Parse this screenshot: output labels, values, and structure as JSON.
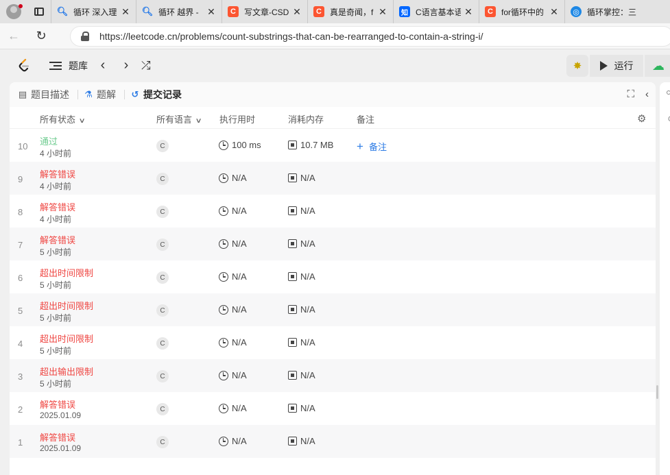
{
  "browser": {
    "tabs": [
      {
        "favicon": "search-icon",
        "title": "循环 深入理"
      },
      {
        "favicon": "search-icon",
        "title": "循环 越界 -"
      },
      {
        "favicon": "csdn-icon",
        "title": "写文章-CSD"
      },
      {
        "favicon": "csdn-icon",
        "title": "真是奇闻，f"
      },
      {
        "favicon": "zhihu-icon",
        "title": "C语言基本语"
      },
      {
        "favicon": "csdn-icon",
        "title": "for循环中的"
      },
      {
        "favicon": "edge-icon",
        "title": "循环掌控：三"
      }
    ],
    "url": "https://leetcode.cn/problems/count-substrings-that-can-be-rearranged-to-contain-a-string-i/"
  },
  "header": {
    "library_label": "题库",
    "run_label": "运行"
  },
  "panel": {
    "tabs": [
      {
        "label": "题目描述",
        "icon": "document-icon"
      },
      {
        "label": "题解",
        "icon": "flask-icon"
      },
      {
        "label": "提交记录",
        "icon": "history-icon"
      }
    ]
  },
  "table": {
    "columns": {
      "status": "所有状态",
      "language": "所有语言",
      "runtime": "执行用时",
      "memory": "消耗内存",
      "notes": "备注"
    },
    "rows": [
      {
        "index": "10",
        "status": "通过",
        "status_type": "accepted",
        "time": "4 小时前",
        "lang": "C",
        "runtime": "100 ms",
        "memory": "10.7 MB",
        "note": "备注"
      },
      {
        "index": "9",
        "status": "解答错误",
        "status_type": "error",
        "time": "4 小时前",
        "lang": "C",
        "runtime": "N/A",
        "memory": "N/A"
      },
      {
        "index": "8",
        "status": "解答错误",
        "status_type": "error",
        "time": "4 小时前",
        "lang": "C",
        "runtime": "N/A",
        "memory": "N/A"
      },
      {
        "index": "7",
        "status": "解答错误",
        "status_type": "error",
        "time": "5 小时前",
        "lang": "C",
        "runtime": "N/A",
        "memory": "N/A"
      },
      {
        "index": "6",
        "status": "超出时间限制",
        "status_type": "error",
        "time": "5 小时前",
        "lang": "C",
        "runtime": "N/A",
        "memory": "N/A"
      },
      {
        "index": "5",
        "status": "超出时间限制",
        "status_type": "error",
        "time": "5 小时前",
        "lang": "C",
        "runtime": "N/A",
        "memory": "N/A"
      },
      {
        "index": "4",
        "status": "超出时间限制",
        "status_type": "error",
        "time": "5 小时前",
        "lang": "C",
        "runtime": "N/A",
        "memory": "N/A"
      },
      {
        "index": "3",
        "status": "超出输出限制",
        "status_type": "error",
        "time": "5 小时前",
        "lang": "C",
        "runtime": "N/A",
        "memory": "N/A"
      },
      {
        "index": "2",
        "status": "解答错误",
        "status_type": "error",
        "time": "2025.01.09",
        "lang": "C",
        "runtime": "N/A",
        "memory": "N/A"
      },
      {
        "index": "1",
        "status": "解答错误",
        "status_type": "error",
        "time": "2025.01.09",
        "lang": "C",
        "runtime": "N/A",
        "memory": "N/A"
      }
    ]
  },
  "colors": {
    "accepted": "#2db55d",
    "error": "#ef4743",
    "accent": "#2c7be5"
  }
}
